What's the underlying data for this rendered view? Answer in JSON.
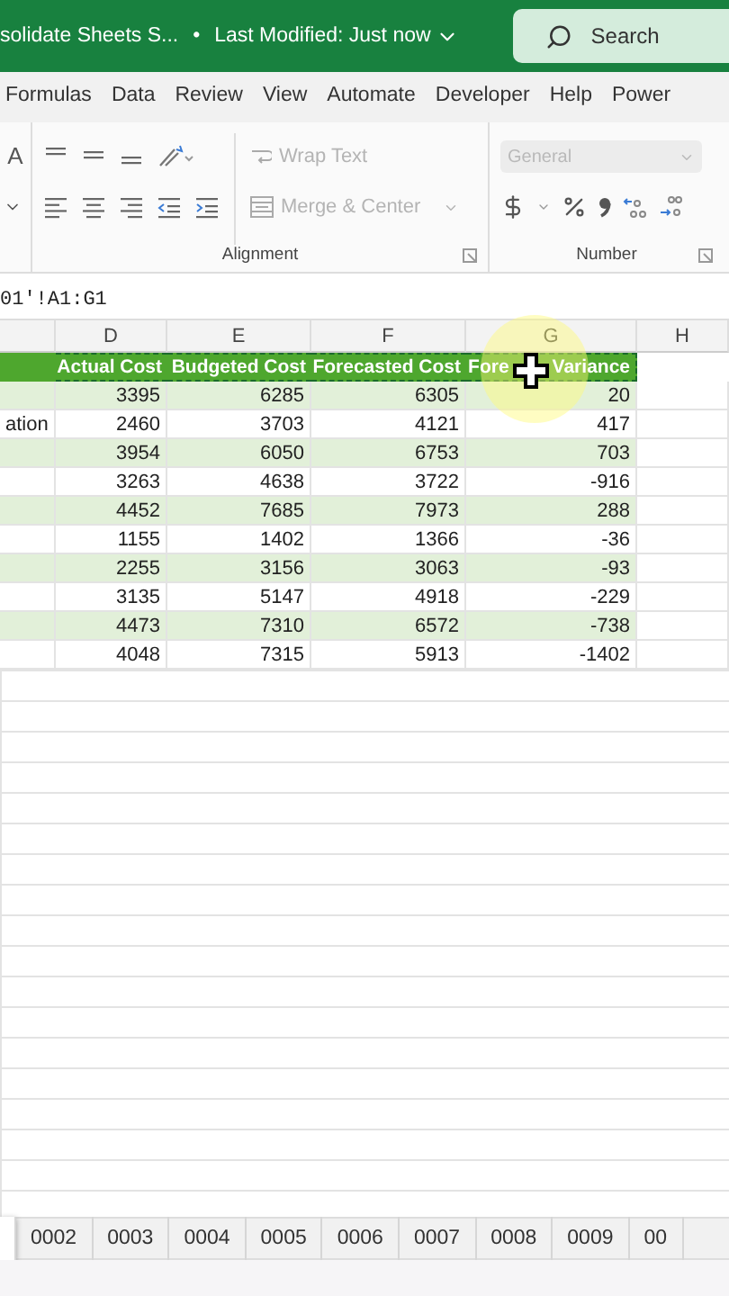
{
  "title_bar": {
    "title": "solidate Sheets S...",
    "separator": "•",
    "status": "Last Modified: Just now",
    "search": {
      "placeholder": "Search"
    }
  },
  "ribbon_tabs": [
    {
      "label": "Formulas",
      "selected": false
    },
    {
      "label": "Data",
      "selected": false
    },
    {
      "label": "Review",
      "selected": false
    },
    {
      "label": "View",
      "selected": false
    },
    {
      "label": "Automate",
      "selected": false
    },
    {
      "label": "Developer",
      "selected": false
    },
    {
      "label": "Help",
      "selected": false
    },
    {
      "label": "Power",
      "selected": false
    }
  ],
  "ribbon": {
    "font_button": "A",
    "wrap_text": {
      "label": "Wrap Text",
      "disabled": true
    },
    "merge_center": {
      "label": "Merge & Center",
      "disabled": true
    },
    "number_format": {
      "value": "General",
      "disabled": true
    },
    "groups": [
      "Alignment",
      "Number"
    ]
  },
  "formula_bar": {
    "reference": "01'!A1:G1"
  },
  "columns": [
    "D",
    "E",
    "F",
    "G",
    "H"
  ],
  "header_row": {
    "cells": [
      "Actual Cost",
      "Budgeted Cost",
      "Forecasted Cost"
    ],
    "last_cell_parts": [
      "Fore",
      "Variance"
    ],
    "copy_marquee": true
  },
  "rows": [
    {
      "c": "",
      "d": "3395",
      "e": "6285",
      "f": "6305",
      "g": "20"
    },
    {
      "c": "ation",
      "d": "2460",
      "e": "3703",
      "f": "4121",
      "g": "417"
    },
    {
      "c": "",
      "d": "3954",
      "e": "6050",
      "f": "6753",
      "g": "703"
    },
    {
      "c": "",
      "d": "3263",
      "e": "4638",
      "f": "3722",
      "g": "-916"
    },
    {
      "c": "",
      "d": "4452",
      "e": "7685",
      "f": "7973",
      "g": "288"
    },
    {
      "c": "",
      "d": "1155",
      "e": "1402",
      "f": "1366",
      "g": "-36"
    },
    {
      "c": "",
      "d": "2255",
      "e": "3156",
      "f": "3063",
      "g": "-93"
    },
    {
      "c": "",
      "d": "3135",
      "e": "5147",
      "f": "4918",
      "g": "-229"
    },
    {
      "c": "",
      "d": "4473",
      "e": "7310",
      "f": "6572",
      "g": "-738"
    },
    {
      "c": "",
      "d": "4048",
      "e": "7315",
      "f": "5913",
      "g": "-1402"
    }
  ],
  "sheet_tabs": [
    {
      "selected": true
    },
    {
      "label": "0002",
      "selected": false
    },
    {
      "label": "0003",
      "selected": false
    },
    {
      "label": "0004",
      "selected": false
    },
    {
      "label": "0005",
      "selected": false
    },
    {
      "label": "0006",
      "selected": false
    },
    {
      "label": "0007",
      "selected": false
    },
    {
      "label": "0008",
      "selected": false
    },
    {
      "label": "0009",
      "selected": false
    },
    {
      "label": "00",
      "selected": false
    }
  ]
}
